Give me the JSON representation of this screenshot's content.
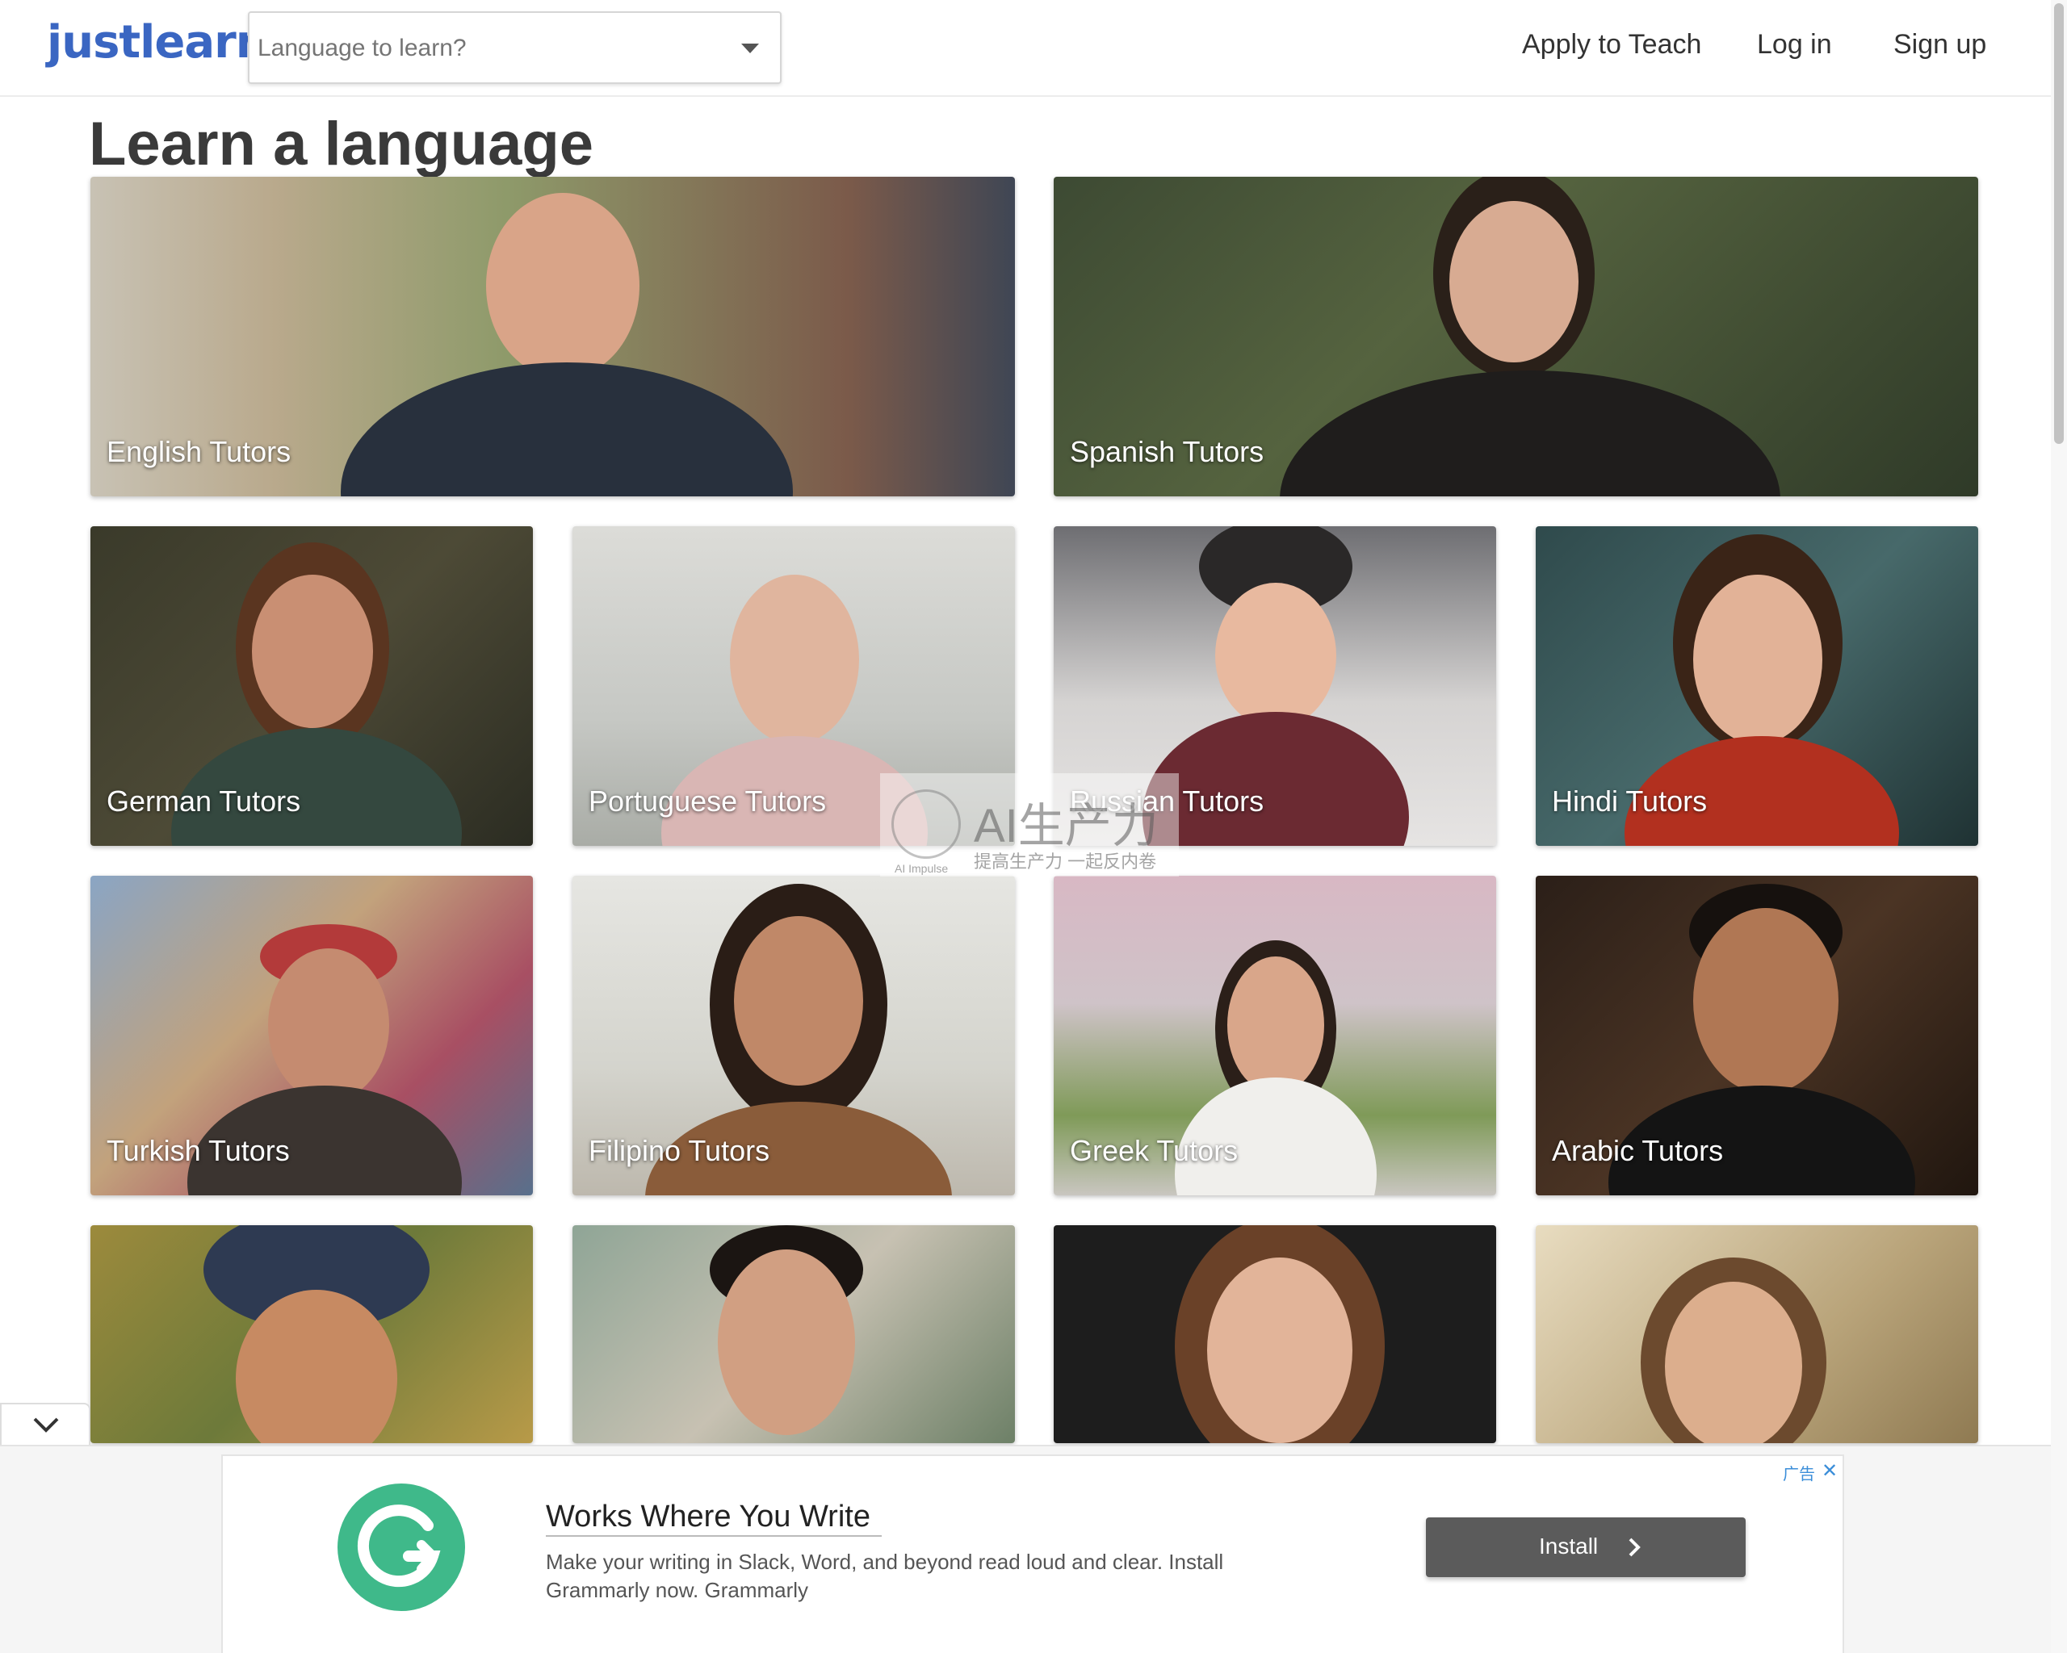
{
  "header": {
    "logo": "justlearn",
    "search": {
      "placeholder": "Language to learn?"
    },
    "nav": {
      "apply": "Apply to Teach",
      "login": "Log in",
      "signup": "Sign up"
    }
  },
  "page": {
    "title": "Learn a language"
  },
  "tutors": [
    {
      "label": "English Tutors"
    },
    {
      "label": "Spanish Tutors"
    },
    {
      "label": "German Tutors"
    },
    {
      "label": "Portuguese Tutors"
    },
    {
      "label": "Russian Tutors"
    },
    {
      "label": "Hindi Tutors"
    },
    {
      "label": "Turkish Tutors"
    },
    {
      "label": "Filipino Tutors"
    },
    {
      "label": "Greek Tutors"
    },
    {
      "label": "Arabic Tutors"
    }
  ],
  "watermark": {
    "main": "AI生产力",
    "sub": "提高生产力 一起反内卷",
    "small": "AI Impulse"
  },
  "ad": {
    "title": "Works Where You Write",
    "description": "Make your writing in Slack, Word, and beyond read loud and clear. Install Grammarly now. Grammarly",
    "button": "Install",
    "tag": "广告",
    "close": "✕"
  },
  "colors": {
    "brand": "#3a66c2",
    "grammarly": "#3fb98a",
    "ad_button": "#5b5b5b"
  }
}
